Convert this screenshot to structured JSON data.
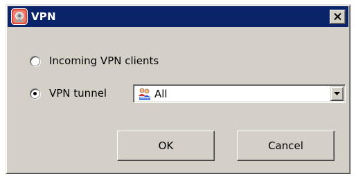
{
  "window": {
    "title": "VPN",
    "title_bar_color": "#0a246a",
    "app_icon": "vpn-shield-icon",
    "close_icon": "close-icon"
  },
  "options": [
    {
      "label": "Incoming VPN clients",
      "selected": false
    },
    {
      "label": "VPN tunnel",
      "selected": true
    }
  ],
  "tunnel_select": {
    "value": "All",
    "icon": "users-icon",
    "arrow_icon": "chevron-down-icon"
  },
  "buttons": {
    "ok": "OK",
    "cancel": "Cancel"
  }
}
